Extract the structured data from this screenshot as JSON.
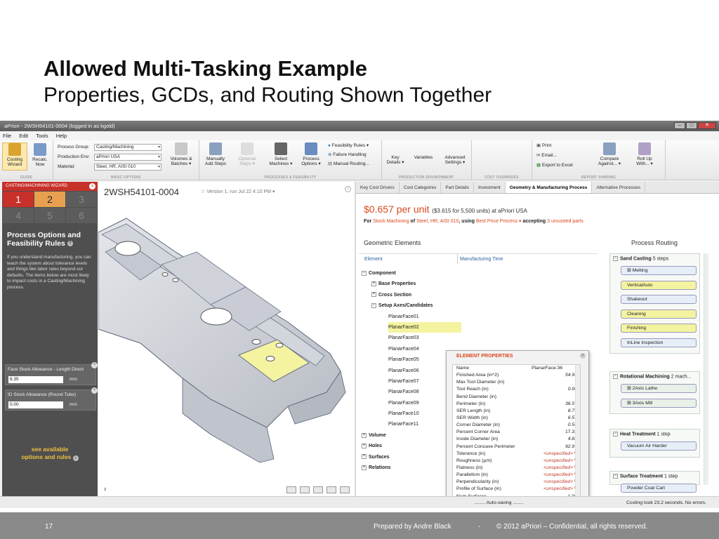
{
  "slide": {
    "title": "Allowed Multi-Tasking Example",
    "subtitle": "Properties, GCDs, and Routing Shown Together",
    "footer": {
      "page": "17",
      "prepared": "Prepared by Andre Black",
      "dash": "-",
      "copyright": "© 2012 aPriori – Confidential, all rights reserved."
    }
  },
  "app": {
    "window_title": "aPriori - 2WSH54101-0004 (logged in as kgold)",
    "menu": [
      "File",
      "Edit",
      "Tools",
      "Help"
    ],
    "ribbon": {
      "guide": {
        "label": "GUIDE",
        "costing_wizard": "Costing\nWizard",
        "recalc_now": "Recalc.\nNow"
      },
      "basic": {
        "label": "BASIC OPTIONS",
        "process_group_label": "Process Group:",
        "process_group": "Casting/Machining",
        "production_env_label": "Production Env:",
        "production_env": "aPriori USA",
        "material_label": "Material:",
        "material": "Steel, HR, AISI 010",
        "volumes": "Volumes &\nBatches ▾"
      },
      "processes": {
        "label": "PROCESSES & FEASIBILITY",
        "manually_add_steps": "Manually\nAdd Steps",
        "optional_steps": "Optional\nSteps ▾",
        "select_machines": "Select\nMachines ▾",
        "process_options": "Process\nOptions ▾",
        "feasibility_rules": "Feasibility Rules ▾",
        "failure_handling": "Failure Handling",
        "manual_routing": "Manual Routing..."
      },
      "production": {
        "label": "PRODUCTION ENVIRONMENT",
        "key_details": "Key\nDetails ▾",
        "variables": "Variables",
        "advanced_settings": "Advanced\nSettings ▾"
      },
      "cost_overrides": {
        "label": "COST OVERRIDES"
      },
      "report": {
        "label": "REPORT SHARING",
        "print": "Print",
        "email": "Email...",
        "export_excel": "Export to Excel",
        "compare_against": "Compare\nAgainst... ▾",
        "roll_up_with": "Roll Up\nWith... ▾"
      }
    },
    "wizard": {
      "header": "CASTING/MACHINING WIZARD",
      "steps": [
        "1",
        "2",
        "3",
        "4",
        "5",
        "6"
      ],
      "title": "Process Options and Feasibility Rules",
      "description": "If you understand manufacturing, you can teach the system about tolerance levels and things like labor rates beyond our defaults. The items below are most likely to impact costs in a Casting/Machining process.",
      "fields": [
        {
          "label": "Face Stock Allowance - Length Direct",
          "value": "6.35",
          "unit": "mm"
        },
        {
          "label": "ID Stock Allowance (Round Tube)",
          "value": "0.00",
          "unit": "mm"
        }
      ],
      "link": "see available\noptions and rules"
    },
    "viewport": {
      "part_name": "2WSH54101-0004",
      "version": "Version 1, run Jul 22 4:10 PM ▾",
      "axis": "z"
    },
    "right": {
      "tabs": [
        "Key Cost Drivers",
        "Cost Categories",
        "Part Details",
        "Investment",
        "Geometry & Manufacturing Process",
        "Alternative Processes"
      ],
      "active_tab": 4,
      "price_main": "$0.657 per unit",
      "price_detail": "($3.615 for 5,500 units) at aPriori USA",
      "for_line": {
        "for": "For",
        "process": "Stock Machining",
        "of": "of",
        "material": "Steel, HR, AISI 010",
        "using": ", using",
        "strategy": "Best Price Process ▾",
        "accepting": "accepting",
        "uncosted": "3 uncosted parts"
      },
      "geometric_elements_title": "Geometric Elements",
      "process_routing_title": "Process Routing",
      "grid_headers": [
        "Element",
        "Manufacturing Time"
      ],
      "tree": [
        {
          "label": "Component",
          "indent": 0,
          "bold": true,
          "exp": "−"
        },
        {
          "label": "Base Properties",
          "indent": 1,
          "bold": true,
          "exp": "+"
        },
        {
          "label": "Cross Section",
          "indent": 1,
          "bold": true,
          "exp": "+"
        },
        {
          "label": "Setup Axes/Candidates",
          "indent": 1,
          "bold": true,
          "exp": "−"
        },
        {
          "label": "PlanarFace01",
          "indent": 2
        },
        {
          "label": "PlanarFace02",
          "indent": 2,
          "highlight": true
        },
        {
          "label": "PlanarFace03",
          "indent": 2
        },
        {
          "label": "PlanarFace04",
          "indent": 2
        },
        {
          "label": "PlanarFace05",
          "indent": 2
        },
        {
          "label": "PlanarFace06",
          "indent": 2
        },
        {
          "label": "PlanarFace07",
          "indent": 2
        },
        {
          "label": "PlanarFace08",
          "indent": 2
        },
        {
          "label": "PlanarFace09",
          "indent": 2
        },
        {
          "label": "PlanarFace10",
          "indent": 2
        },
        {
          "label": "PlanarFace11",
          "indent": 2
        },
        {
          "label": "Volume",
          "indent": 0,
          "bold": true,
          "exp": "+"
        },
        {
          "label": "Holes",
          "indent": 0,
          "bold": true,
          "exp": "+"
        },
        {
          "label": "Surfaces",
          "indent": 0,
          "bold": true,
          "exp": "+"
        },
        {
          "label": "Relations",
          "indent": 0,
          "bold": true,
          "exp": "+"
        }
      ],
      "element_properties": {
        "title": "ELEMENT PROPERTIES",
        "rows": [
          {
            "k": "Name",
            "v": "PlanarFace:36",
            "t": "n"
          },
          {
            "k": "Finished Area (in^2)",
            "v": "54.95"
          },
          {
            "k": "Max Tool Diameter (in)",
            "v": "-"
          },
          {
            "k": "Tool Reach (in)",
            "v": "0.00"
          },
          {
            "k": "Bend Diameter (in)",
            "v": ""
          },
          {
            "k": "Perimeter (in)",
            "v": "36.57"
          },
          {
            "k": "SER Length (in)",
            "v": "8.79"
          },
          {
            "k": "SER Width (in)",
            "v": "6.57"
          },
          {
            "k": "Corner Diameter (in)",
            "v": "0.54"
          },
          {
            "k": "Percent Corner Area",
            "v": "17.32",
            "t": "n"
          },
          {
            "k": "Inside Diameter (in)",
            "v": "4.81"
          },
          {
            "k": "Percent Concave Perimeter",
            "v": "92.97"
          },
          {
            "k": "Tolerance (in)",
            "v": "<unspecified>✎",
            "t": "u"
          },
          {
            "k": "Roughness (µm)",
            "v": "<unspecified>✎",
            "t": "u"
          },
          {
            "k": "Flatness (in)",
            "v": "<unspecified>✎",
            "t": "u"
          },
          {
            "k": "Parallelism (in)",
            "v": "<unspecified>✎",
            "t": "u"
          },
          {
            "k": "Perpendicularity (in)",
            "v": "<unspecified>✎",
            "t": "u"
          },
          {
            "k": "Profile of Surface (in)",
            "v": "<unspecified>✎",
            "t": "u"
          },
          {
            "k": "Num Surfaces",
            "v": "1.00",
            "t": "n"
          },
          {
            "k": "On Bounding Box",
            "v": "false",
            "t": "n"
          }
        ]
      },
      "routing": [
        {
          "name": "Sand Casting",
          "count": "5 steps",
          "steps": [
            {
              "label": "⊞ Melting"
            },
            {
              "label": "VerticalAuto",
              "y": true
            },
            {
              "label": "Shakeout"
            },
            {
              "label": "Cleaning",
              "y": true
            },
            {
              "label": "Finishing",
              "y": true
            },
            {
              "label": "InLine Inspection"
            }
          ]
        },
        {
          "name": "Rotational Machining",
          "count": "2 mach...",
          "steps": [
            {
              "label": "⊞ 2Axis Lathe",
              "g": true
            },
            {
              "label": "⊞ 3Axis Mill",
              "g": true
            }
          ]
        },
        {
          "name": "Heat Treatment",
          "count": "1 step",
          "steps": [
            {
              "label": "Vacuum Air Harder"
            }
          ]
        },
        {
          "name": "Surface Treatment",
          "count": "1 step",
          "steps": [
            {
              "label": "Powder Coat Cart"
            }
          ]
        }
      ]
    },
    "status": {
      "autosave": "........ Auto-saving ........",
      "costing": "Costing took 23.2 seconds. No errors."
    }
  }
}
